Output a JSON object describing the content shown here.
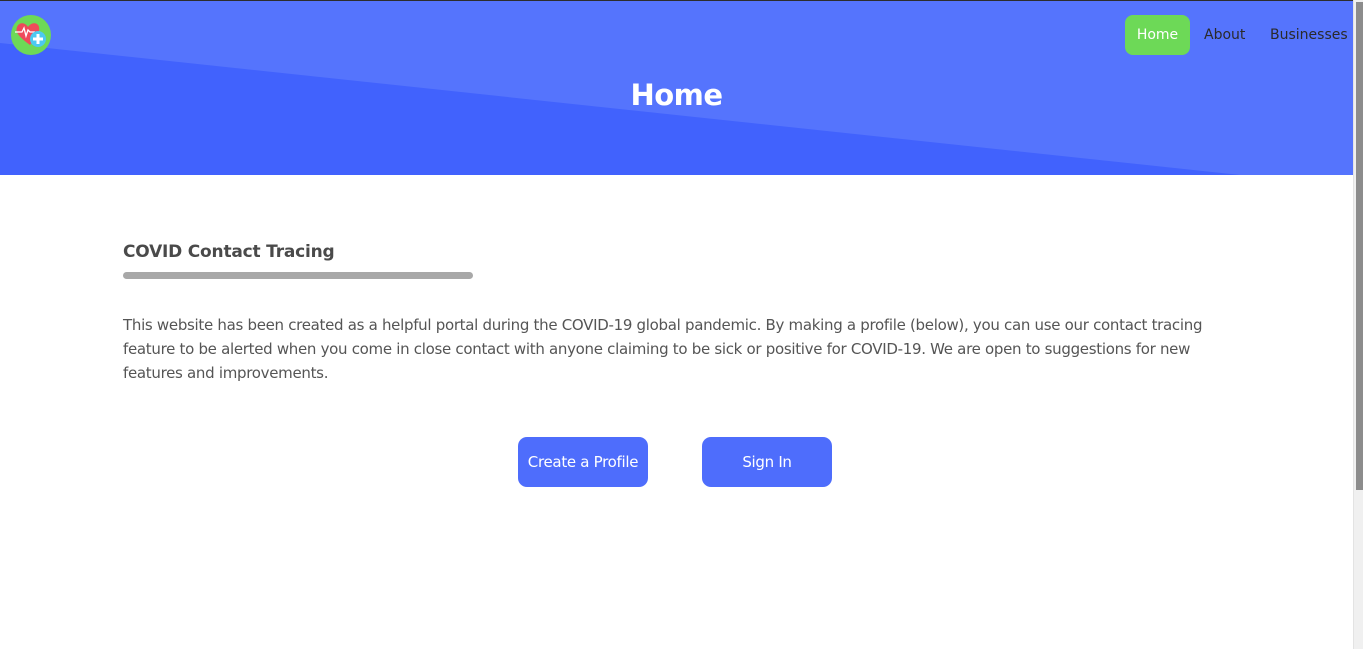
{
  "page": {
    "title": "Home"
  },
  "nav": {
    "items": [
      {
        "label": "Home",
        "active": true
      },
      {
        "label": "About",
        "active": false
      },
      {
        "label": "Businesses",
        "active": false
      }
    ]
  },
  "logo": {
    "icon": "heart-pulse-plus-icon"
  },
  "main": {
    "heading": "COVID Contact Tracing",
    "description": "This website has been created as a helpful portal during the COVID-19 global pandemic. By making a profile (below), you can use our contact tracing feature to be alerted when you come in close contact with anyone claiming to be sick or positive for COVID-19. We are open to suggestions for new features and improvements.",
    "buttons": {
      "create_profile": "Create a Profile",
      "sign_in": "Sign In"
    }
  },
  "colors": {
    "hero_light": "#5574fd",
    "hero_dark": "#4162fd",
    "nav_active": "#6dd957",
    "button": "#4e6dfc",
    "underline": "#a8a8a8"
  }
}
